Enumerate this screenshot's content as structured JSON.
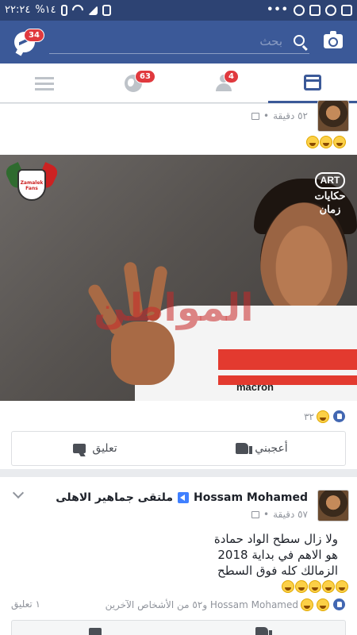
{
  "status_bar": {
    "time": "٢٢:٢٤",
    "battery": "%١٤",
    "icons": [
      "battery-icon",
      "wifi-icon",
      "signal-icon",
      "alarm-icon"
    ],
    "notification_icons": [
      "photo-icon",
      "whatsapp-icon",
      "instagram-icon",
      "whatsapp-icon",
      "more-dots-icon"
    ]
  },
  "top_bar": {
    "messenger_badge": "34",
    "search_placeholder": "بحث",
    "accent_color": "#3b5998"
  },
  "tabs": [
    {
      "name": "menu",
      "icon": "hamburger-icon",
      "badge": ""
    },
    {
      "name": "notifications",
      "icon": "globe-icon",
      "badge": "63"
    },
    {
      "name": "friend-requests",
      "icon": "friends-icon",
      "badge": "4"
    },
    {
      "name": "news-feed",
      "icon": "feed-icon",
      "badge": "",
      "active": true
    }
  ],
  "post1": {
    "time": "٥٢ دقيقة",
    "separator": "•",
    "caption_emojis": 3,
    "image": {
      "tv_logo_top": "ART",
      "tv_logo_bottom": "حكايات زمان",
      "shirt_brand": "macron",
      "watermark": "المواطن",
      "club_logo_text": "Zamalek Fans"
    },
    "reaction_count": "٣٢",
    "like_label": "أعجبني",
    "comment_label": "تعليق"
  },
  "post2": {
    "author": "Hossam Mohamed",
    "group": "ملتقى جماهير الاهلى",
    "time": "٥٧ دقيقة",
    "separator": "•",
    "text_lines": [
      "ولا زال سطح الواد حمادة",
      "هو الاهم في بداية 2018",
      "الزمالك كله فوق السطح"
    ],
    "text_emojis": 5,
    "reactions_text": "Hossam Mohamed و٥٢ من الأشخاص الآخرين",
    "comments_count": "١ تعليق"
  }
}
